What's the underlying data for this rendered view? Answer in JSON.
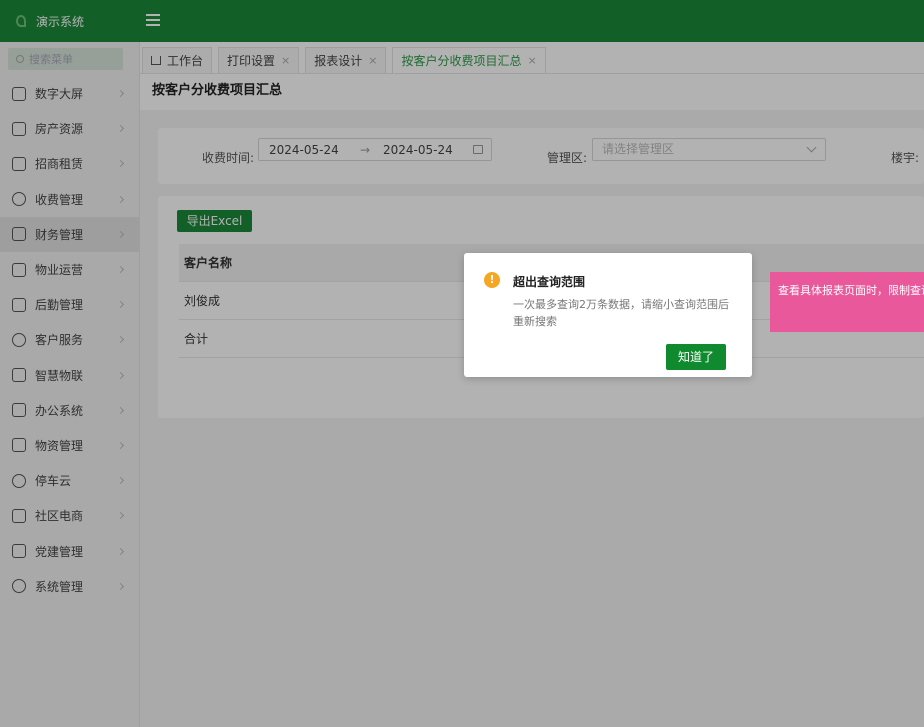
{
  "app": {
    "title": "演示系统"
  },
  "sidebar": {
    "search_placeholder": "搜索菜单",
    "items": [
      {
        "label": "数字大屏",
        "icon": "monitor-icon"
      },
      {
        "label": "房产资源",
        "icon": "building-icon"
      },
      {
        "label": "招商租赁",
        "icon": "home-icon"
      },
      {
        "label": "收费管理",
        "icon": "money-bag-icon"
      },
      {
        "label": "财务管理",
        "icon": "ledger-icon"
      },
      {
        "label": "物业运营",
        "icon": "house-gear-icon"
      },
      {
        "label": "后勤管理",
        "icon": "house-gear-icon"
      },
      {
        "label": "客户服务",
        "icon": "user-icon"
      },
      {
        "label": "智慧物联",
        "icon": "iot-icon"
      },
      {
        "label": "办公系统",
        "icon": "briefcase-icon"
      },
      {
        "label": "物资管理",
        "icon": "warehouse-icon"
      },
      {
        "label": "停车云",
        "icon": "parking-icon"
      },
      {
        "label": "社区电商",
        "icon": "shop-icon"
      },
      {
        "label": "党建管理",
        "icon": "home-icon"
      },
      {
        "label": "系统管理",
        "icon": "gear-icon"
      }
    ]
  },
  "tabs": [
    {
      "label": "工作台"
    },
    {
      "label": "打印设置"
    },
    {
      "label": "报表设计"
    },
    {
      "label": "按客户分收费项目汇总"
    }
  ],
  "page": {
    "title": "按客户分收费项目汇总"
  },
  "filters": {
    "date_label": "收费时间:",
    "date_start": "2024-05-24",
    "date_arrow": "→",
    "date_end": "2024-05-24",
    "area_label": "管理区:",
    "area_placeholder": "请选择管理区",
    "building_label": "楼宇:"
  },
  "table": {
    "export_label": "导出Excel",
    "header": "客户名称",
    "rows": [
      "刘俊成",
      "合计"
    ]
  },
  "toast": {
    "text": "查看具体报表页面时，限制查询"
  },
  "dialog": {
    "title": "超出查询范围",
    "body": "一次最多查询2万条数据，请缩小查询范围后重新搜索",
    "ok_label": "知道了",
    "warn_glyph": "!"
  },
  "colors": {
    "brand": "#1b8a3a",
    "toast": "#e8589a",
    "warning": "#f5a623"
  }
}
